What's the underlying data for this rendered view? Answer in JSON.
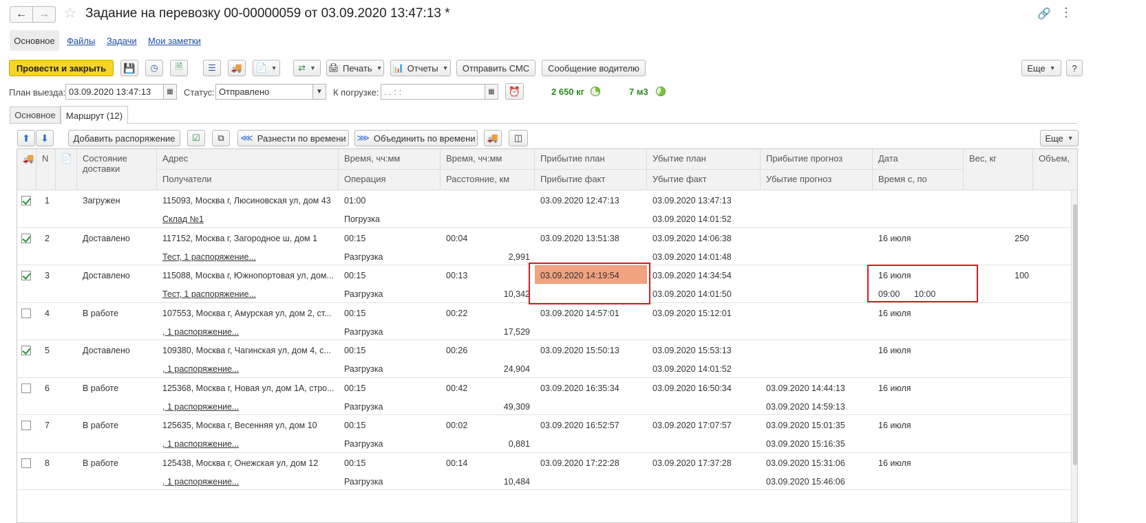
{
  "window": {
    "title": "Задание на перевозку 00-00000059 от 03.09.2020 13:47:13 *"
  },
  "nav_tabs": [
    "Основное",
    "Файлы",
    "Задачи",
    "Мои заметки"
  ],
  "toolbar": {
    "post_close": "Провести и закрыть",
    "print": "Печать",
    "reports": "Отчеты",
    "send_sms": "Отправить СМС",
    "driver_msg": "Сообщение водителю",
    "more": "Еще",
    "help": "?"
  },
  "form": {
    "plan_label": "План выезда:",
    "plan_value": "03.09.2020 13:47:13",
    "status_label": "Статус:",
    "status_value": "Отправлено",
    "loading_label": "К погрузке:",
    "loading_value": " .  .      :  :",
    "weight": "2 650 кг",
    "volume": "7 м3"
  },
  "inner_tabs": [
    "Основное",
    "Маршрут (12)"
  ],
  "grid_toolbar": {
    "add_order": "Добавить распоряжение",
    "spread_time": "Разнести по времени",
    "merge_time": "Объединить по времени",
    "more": "Еще"
  },
  "columns": {
    "n": "N",
    "state": "Состояние доставки",
    "address": "Адрес",
    "recipients": "Получатели",
    "time": "Время, чч:мм",
    "operation": "Операция",
    "time2": "Время, чч:мм",
    "distance": "Расстояние, км",
    "arr_plan": "Прибытие план",
    "arr_fact": "Прибытие факт",
    "dep_plan": "Убытие план",
    "dep_fact": "Убытие факт",
    "arr_fc": "Прибытие прогноз",
    "dep_fc": "Убытие прогноз",
    "date": "Дата",
    "time_from_to": "Время с, по",
    "weight": "Вес, кг",
    "volume": "Объем,"
  },
  "rows": [
    {
      "checked": true,
      "n": "1",
      "state": "Загружен",
      "address": "115093, Москва г, Люсиновская ул, дом 43",
      "recipient": "Склад №1",
      "time": "01:00",
      "operation": "Погрузка",
      "time2": "",
      "distance": "",
      "arr_plan": "03.09.2020 12:47:13",
      "arr_fact": "",
      "dep_plan": "03.09.2020 13:47:13",
      "dep_fact": "03.09.2020 14:01:52",
      "arr_fc": "",
      "dep_fc": "",
      "date": "",
      "time_from": "",
      "time_to": "",
      "weight": ""
    },
    {
      "checked": true,
      "n": "2",
      "state": "Доставлено",
      "address": "117152, Москва г, Загородное ш, дом 1",
      "recipient": "Тест, 1 распоряжение...",
      "time": "00:15",
      "operation": "Разгрузка",
      "time2": "00:04",
      "distance": "2,991",
      "arr_plan": "03.09.2020 13:51:38",
      "arr_fact": "",
      "dep_plan": "03.09.2020 14:06:38",
      "dep_fact": "03.09.2020 14:01:48",
      "arr_fc": "",
      "dep_fc": "",
      "date": "16 июля",
      "time_from": "",
      "time_to": "",
      "weight": "250"
    },
    {
      "checked": true,
      "n": "3",
      "state": "Доставлено",
      "address": "115088, Москва г, Южнопортовая ул, дом...",
      "recipient": "Тест, 1 распоряжение...",
      "time": "00:15",
      "operation": "Разгрузка",
      "time2": "00:13",
      "distance": "10,342",
      "arr_plan": "03.09.2020 14:19:54",
      "arr_fact": "",
      "dep_plan": "03.09.2020 14:34:54",
      "dep_fact": "03.09.2020 14:01:50",
      "arr_fc": "",
      "dep_fc": "",
      "date": "16 июля",
      "time_from": "09:00",
      "time_to": "10:00",
      "weight": "100",
      "highlight": true
    },
    {
      "checked": false,
      "n": "4",
      "state": "В работе",
      "address": "107553, Москва г, Амурская ул, дом 2, ст...",
      "recipient": ", 1 распоряжение...",
      "time": "00:15",
      "operation": "Разгрузка",
      "time2": "00:22",
      "distance": "17,529",
      "arr_plan": "03.09.2020 14:57:01",
      "arr_fact": "",
      "dep_plan": "03.09.2020 15:12:01",
      "dep_fact": "",
      "arr_fc": "",
      "dep_fc": "",
      "date": "16 июля",
      "time_from": "",
      "time_to": "",
      "weight": ""
    },
    {
      "checked": true,
      "n": "5",
      "state": "Доставлено",
      "address": "109380, Москва г, Чагинская ул, дом 4, с...",
      "recipient": ", 1 распоряжение...",
      "time": "00:15",
      "operation": "Разгрузка",
      "time2": "00:26",
      "distance": "24,904",
      "arr_plan": "03.09.2020 15:50:13",
      "arr_fact": "",
      "dep_plan": "03.09.2020 15:53:13",
      "dep_fact": "03.09.2020 14:01:52",
      "arr_fc": "",
      "dep_fc": "",
      "date": "16 июля",
      "time_from": "",
      "time_to": "",
      "weight": ""
    },
    {
      "checked": false,
      "n": "6",
      "state": "В работе",
      "address": "125368, Москва г, Новая ул, дом 1А, стро...",
      "recipient": ", 1 распоряжение...",
      "time": "00:15",
      "operation": "Разгрузка",
      "time2": "00:42",
      "distance": "49,309",
      "arr_plan": "03.09.2020 16:35:34",
      "arr_fact": "",
      "dep_plan": "03.09.2020 16:50:34",
      "dep_fact": "",
      "arr_fc": "03.09.2020 14:44:13",
      "dep_fc": "03.09.2020 14:59:13",
      "date": "16 июля",
      "time_from": "",
      "time_to": "",
      "weight": ""
    },
    {
      "checked": false,
      "n": "7",
      "state": "В работе",
      "address": "125635, Москва г, Весенняя ул, дом 10",
      "recipient": ", 1 распоряжение...",
      "time": "00:15",
      "operation": "Разгрузка",
      "time2": "00:02",
      "distance": "0,881",
      "arr_plan": "03.09.2020 16:52:57",
      "arr_fact": "",
      "dep_plan": "03.09.2020 17:07:57",
      "dep_fact": "",
      "arr_fc": "03.09.2020 15:01:35",
      "dep_fc": "03.09.2020 15:16:35",
      "date": "16 июля",
      "time_from": "",
      "time_to": "",
      "weight": ""
    },
    {
      "checked": false,
      "n": "8",
      "state": "В работе",
      "address": "125438, Москва г, Онежская ул, дом 12",
      "recipient": ", 1 распоряжение...",
      "time": "00:15",
      "operation": "Разгрузка",
      "time2": "00:14",
      "distance": "10,484",
      "arr_plan": "03.09.2020 17:22:28",
      "arr_fact": "",
      "dep_plan": "03.09.2020 17:37:28",
      "dep_fact": "",
      "arr_fc": "03.09.2020 15:31:06",
      "dep_fc": "03.09.2020 15:46:06",
      "date": "16 июля",
      "time_from": "",
      "time_to": "",
      "weight": ""
    }
  ]
}
